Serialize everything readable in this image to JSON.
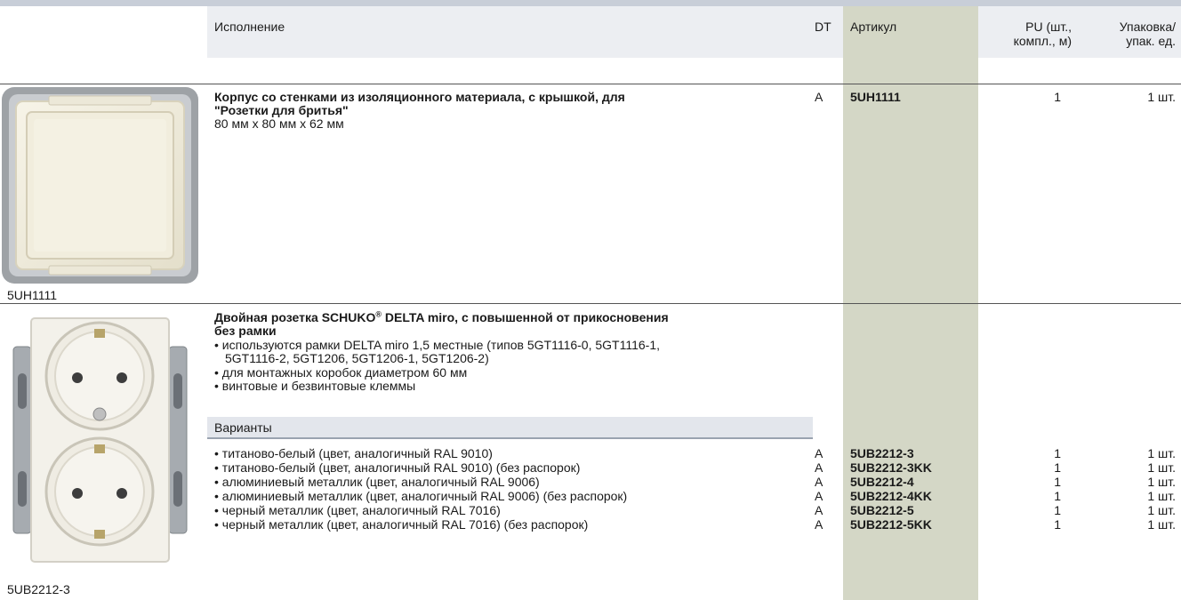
{
  "header": {
    "col_design": "Исполнение",
    "col_dt": "DT",
    "col_article": "Артикул",
    "col_pu_line1": "PU (шт.,",
    "col_pu_line2": "компл., м)",
    "col_pack_line1": "Упаковка/",
    "col_pack_line2": "упак. ед."
  },
  "product1": {
    "title_line1": "Корпус со стенками из изоляционного материала, с крышкой, для",
    "title_line2": "\"Розетки для бритья\"",
    "dimensions": "80 мм x 80 мм x 62 мм",
    "dt": "A",
    "article": "5UH1111",
    "pu": "1",
    "pack": "1 шт.",
    "image_caption": "5UH1111"
  },
  "product2": {
    "title_line1a": "Двойная розетка SCHUKO",
    "title_reg": "®",
    "title_line1b": " DELTA miro, с повышенной от прикосновения",
    "title_line2": "без рамки",
    "bullet1_line1": "• используются рамки DELTA miro 1,5 местные (типов 5GT1116-0, 5GT1116-1,",
    "bullet1_line2": "5GT1116-2, 5GT1206, 5GT1206-1, 5GT1206-2)",
    "bullet2": "• для монтажных коробок диаметром 60 мм",
    "bullet3": "• винтовые и безвинтовые клеммы",
    "variants_label": "Варианты",
    "image_caption": "5UB2212-3",
    "variants": [
      {
        "desc": "• титаново-белый (цвет, аналогичный RAL 9010)",
        "dt": "A",
        "article": "5UB2212-3",
        "pu": "1",
        "pack": "1 шт."
      },
      {
        "desc": "• титаново-белый (цвет, аналогичный RAL 9010) (без распорок)",
        "dt": "A",
        "article": "5UB2212-3KK",
        "pu": "1",
        "pack": "1 шт."
      },
      {
        "desc": "• алюминиевый металлик (цвет, аналогичный RAL 9006)",
        "dt": "A",
        "article": "5UB2212-4",
        "pu": "1",
        "pack": "1 шт."
      },
      {
        "desc": "• алюминиевый металлик (цвет, аналогичный RAL 9006) (без распорок)",
        "dt": "A",
        "article": "5UB2212-4KK",
        "pu": "1",
        "pack": "1 шт."
      },
      {
        "desc": "• черный металлик (цвет, аналогичный RAL 7016)",
        "dt": "A",
        "article": "5UB2212-5",
        "pu": "1",
        "pack": "1 шт."
      },
      {
        "desc": "• черный металлик (цвет, аналогичный RAL 7016) (без распорок)",
        "dt": "A",
        "article": "5UB2212-5KK",
        "pu": "1",
        "pack": "1 шт."
      }
    ]
  }
}
